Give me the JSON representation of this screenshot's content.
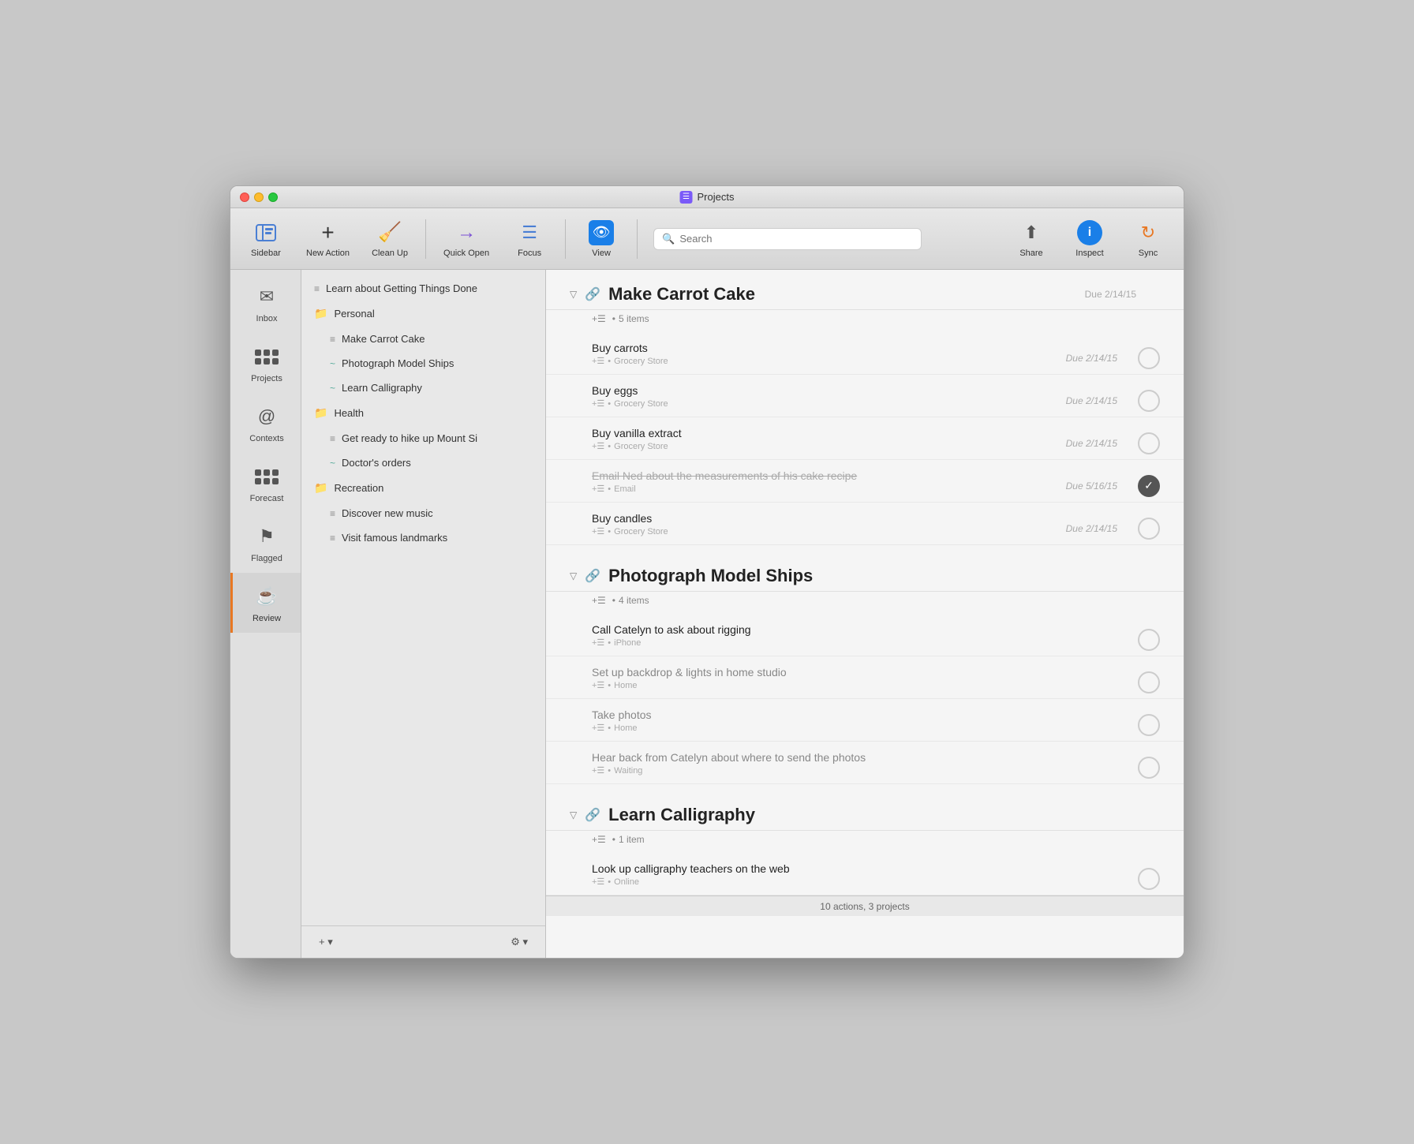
{
  "window": {
    "title": "Projects"
  },
  "titlebar": {
    "title": "Projects"
  },
  "toolbar": {
    "sidebar_label": "Sidebar",
    "new_action_label": "New Action",
    "clean_up_label": "Clean Up",
    "quick_open_label": "Quick Open",
    "focus_label": "Focus",
    "view_label": "View",
    "search_placeholder": "Search",
    "search_label": "Search",
    "share_label": "Share",
    "inspect_label": "Inspect",
    "sync_label": "Sync"
  },
  "sidebar_icons": [
    {
      "id": "inbox",
      "label": "Inbox",
      "icon": "✉",
      "active": false
    },
    {
      "id": "projects",
      "label": "Projects",
      "icon": "projects",
      "active": false
    },
    {
      "id": "contexts",
      "label": "Contexts",
      "icon": "@",
      "active": false
    },
    {
      "id": "forecast",
      "label": "Forecast",
      "icon": "forecast",
      "active": false
    },
    {
      "id": "flagged",
      "label": "Flagged",
      "icon": "⚑",
      "active": false
    },
    {
      "id": "review",
      "label": "Review",
      "icon": "☕",
      "active": true
    }
  ],
  "projects_sidebar": {
    "top_item": "Learn about Getting Things Done",
    "groups": [
      {
        "id": "personal",
        "label": "Personal",
        "selected": true,
        "items": [
          {
            "id": "make-carrot-cake",
            "label": "Make Carrot Cake"
          },
          {
            "id": "photograph-model-ships",
            "label": "Photograph Model Ships"
          },
          {
            "id": "learn-calligraphy",
            "label": "Learn Calligraphy"
          }
        ]
      },
      {
        "id": "health",
        "label": "Health",
        "selected": false,
        "items": [
          {
            "id": "get-ready-hike",
            "label": "Get ready to hike up Mount Si"
          },
          {
            "id": "doctors-orders",
            "label": "Doctor's orders"
          }
        ]
      },
      {
        "id": "recreation",
        "label": "Recreation",
        "selected": false,
        "items": [
          {
            "id": "discover-music",
            "label": "Discover new music"
          },
          {
            "id": "visit-landmarks",
            "label": "Visit famous landmarks"
          }
        ]
      }
    ],
    "footer": {
      "add_label": "+ ▾",
      "settings_label": "⚙ ▾"
    }
  },
  "content": {
    "projects": [
      {
        "id": "make-carrot-cake",
        "title": "Make Carrot Cake",
        "item_count": "5 items",
        "due": "Due 2/14/15",
        "tasks": [
          {
            "id": "buy-carrots",
            "title": "Buy carrots",
            "meta_icon": "+☰",
            "context": "Grocery Store",
            "due": "Due 2/14/15",
            "checked": false,
            "strikethrough": false
          },
          {
            "id": "buy-eggs",
            "title": "Buy eggs",
            "meta_icon": "+☰",
            "context": "Grocery Store",
            "due": "Due 2/14/15",
            "checked": false,
            "strikethrough": false
          },
          {
            "id": "buy-vanilla",
            "title": "Buy vanilla extract",
            "meta_icon": "+☰",
            "context": "Grocery Store",
            "due": "Due 2/14/15",
            "checked": false,
            "strikethrough": false
          },
          {
            "id": "email-ned",
            "title": "Email Ned about the measurements of his cake recipe",
            "meta_icon": "+☰",
            "context": "Email",
            "due": "Due 5/16/15",
            "checked": true,
            "strikethrough": true
          },
          {
            "id": "buy-candles",
            "title": "Buy candles",
            "meta_icon": "+☰",
            "context": "Grocery Store",
            "due": "Due 2/14/15",
            "checked": false,
            "strikethrough": false
          }
        ]
      },
      {
        "id": "photograph-model-ships",
        "title": "Photograph Model Ships",
        "item_count": "4 items",
        "due": "",
        "tasks": [
          {
            "id": "call-catelyn",
            "title": "Call Catelyn to ask about rigging",
            "meta_icon": "+☰",
            "context": "iPhone",
            "due": "",
            "checked": false,
            "strikethrough": false
          },
          {
            "id": "set-up-backdrop",
            "title": "Set up backdrop & lights in home studio",
            "meta_icon": "+☰",
            "context": "Home",
            "due": "",
            "checked": false,
            "strikethrough": false
          },
          {
            "id": "take-photos",
            "title": "Take photos",
            "meta_icon": "+☰",
            "context": "Home",
            "due": "",
            "checked": false,
            "strikethrough": false
          },
          {
            "id": "hear-back",
            "title": "Hear back from Catelyn about where to send the photos",
            "meta_icon": "+☰",
            "context": "Waiting",
            "due": "",
            "checked": false,
            "strikethrough": false
          }
        ]
      },
      {
        "id": "learn-calligraphy",
        "title": "Learn Calligraphy",
        "item_count": "1 item",
        "due": "",
        "tasks": [
          {
            "id": "look-up-teachers",
            "title": "Look up calligraphy teachers on the web",
            "meta_icon": "+☰",
            "context": "Online",
            "due": "",
            "checked": false,
            "strikethrough": false
          }
        ]
      }
    ],
    "status_bar": "10 actions, 3 projects"
  }
}
